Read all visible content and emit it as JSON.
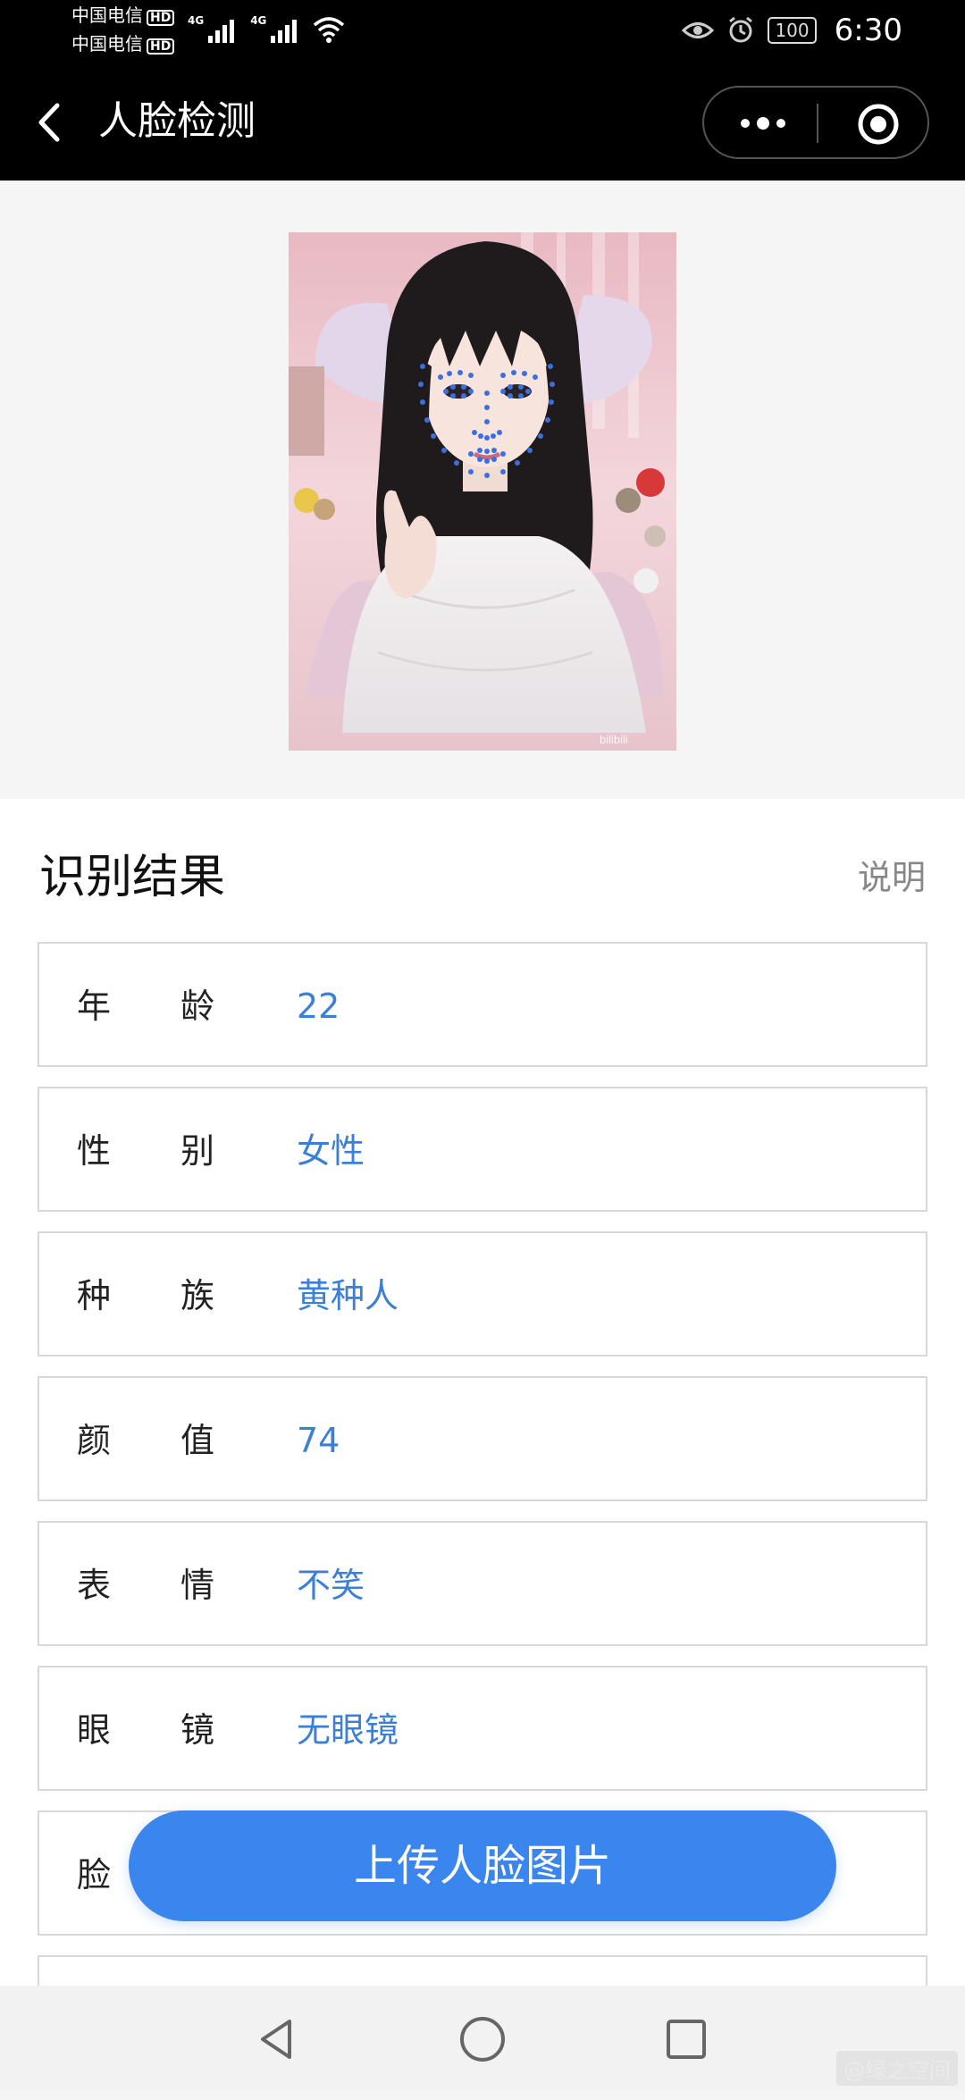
{
  "status_bar": {
    "carrier_1": "中国电信",
    "carrier_2": "中国电信",
    "hd_badge": "HD",
    "network_1": "4G",
    "network_2": "4G",
    "battery": "100",
    "time": "6:30"
  },
  "nav": {
    "title": "人脸检测",
    "icons": [
      "back-icon",
      "more-icon",
      "target-icon"
    ]
  },
  "photo": {
    "watermark": "bilibili"
  },
  "results": {
    "title": "识别结果",
    "help_link": "说明",
    "rows": [
      {
        "label": "年龄",
        "value": "22"
      },
      {
        "label": "性别",
        "value": "女性"
      },
      {
        "label": "种族",
        "value": "黄种人"
      },
      {
        "label": "颜值",
        "value": "74"
      },
      {
        "label": "表情",
        "value": "不笑"
      },
      {
        "label": "眼镜",
        "value": "无眼镜"
      },
      {
        "label": "脸",
        "value": ""
      }
    ]
  },
  "upload_button": "上传人脸图片",
  "system_nav": {
    "icons": [
      "back-triangle-icon",
      "home-circle-icon",
      "recents-square-icon"
    ],
    "watermark": "@绿之空间"
  },
  "colors": {
    "accent": "#3a86ee",
    "value_text": "#3b7fd6",
    "nav_bg": "#000000",
    "page_bg": "#f5f5f5"
  }
}
